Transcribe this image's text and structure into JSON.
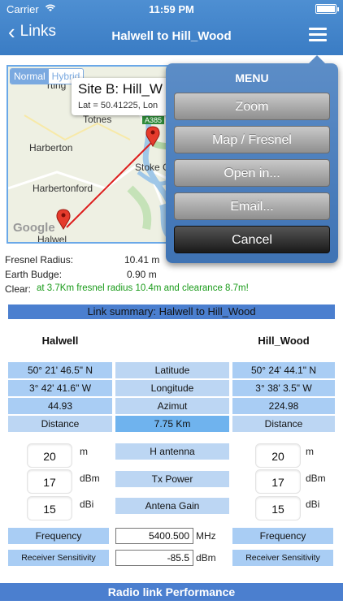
{
  "status": {
    "carrier": "Carrier",
    "time": "11:59 PM"
  },
  "nav": {
    "back_label": "Links",
    "title": "Halwell to Hill_Wood"
  },
  "map": {
    "mode_normal": "Normal",
    "mode_hybrid": "Hybrid",
    "callout_title": "Site B:   Hill_W",
    "callout_sub": "Lat = 50.41225, Lon",
    "labels": {
      "totnes": "Totnes",
      "harberton": "Harberton",
      "harbertonford": "Harbertonford",
      "stoke": "Stoke G",
      "halwell": "Halwel",
      "bertin": "rting",
      "road": "A385"
    },
    "google": "Google"
  },
  "readouts": {
    "fresnel_label": "Fresnel Radius:",
    "fresnel_value": "10.41 m",
    "bulge_label": "Earth Budge:",
    "bulge_value": "0.90 m",
    "clear_label": "Clear:",
    "clear_value": "at 3.7Km  fresnel radius 10.4m and clearance 8.7m!"
  },
  "menu": {
    "title": "MENU",
    "items": [
      "Zoom",
      "Map / Fresnel",
      "Open in...",
      "Email...",
      "Cancel"
    ]
  },
  "summary": {
    "title": "Link summary: Halwell to Hill_Wood",
    "site_a": "Halwell",
    "site_b": "Hill_Wood",
    "rows": [
      {
        "a": "50° 21' 46.5\" N",
        "label": "Latitude",
        "b": "50° 24' 44.1\" N"
      },
      {
        "a": "3° 42' 41.6\" W",
        "label": "Longitude",
        "b": "3° 38' 3.5\" W"
      },
      {
        "a": "44.93",
        "label": "Azimut",
        "b": "224.98"
      },
      {
        "a": "Distance",
        "label": "7.75 Km",
        "b": "Distance"
      }
    ],
    "params": [
      {
        "a": "20",
        "unit_a": "m",
        "label": "H antenna",
        "b": "20",
        "unit_b": "m"
      },
      {
        "a": "17",
        "unit_a": "dBm",
        "label": "Tx Power",
        "b": "17",
        "unit_b": "dBm"
      },
      {
        "a": "15",
        "unit_a": "dBi",
        "label": "Antena Gain",
        "b": "15",
        "unit_b": "dBi"
      }
    ],
    "frequency_label": "Frequency",
    "frequency_value": "5400.500",
    "frequency_unit": "MHz",
    "sensitivity_label": "Receiver Sensitivity",
    "sensitivity_value": "-85.5",
    "sensitivity_unit": "dBm",
    "performance_title": "Radio link Performance"
  },
  "colors": {
    "navbar": "#3a7cc4",
    "cell_blue": "#a9cdf4",
    "cell_dark": "#6fb3ee",
    "summary_bar": "#4b7fcf",
    "clear_text": "#1a9b1a",
    "marker_red": "#e53b2c"
  },
  "icons": [
    "wifi-icon",
    "battery-icon",
    "back-chevron-icon",
    "hamburger-menu-icon",
    "map-marker-icon"
  ]
}
